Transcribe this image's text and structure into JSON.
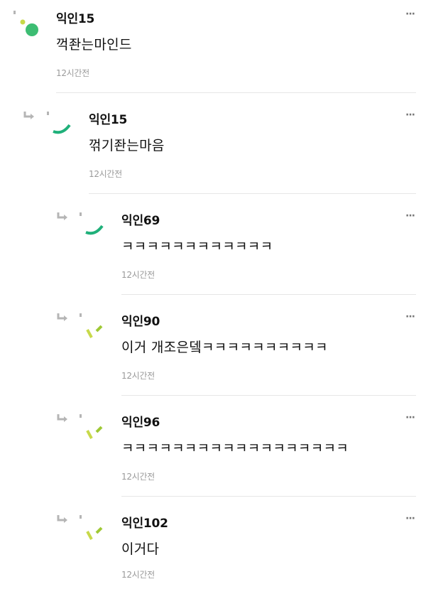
{
  "comments": [
    {
      "author": "익인15",
      "text": "꺽좐는마인드",
      "time": "12시간전"
    },
    {
      "author": "익인15",
      "text": "꺾기좐는마음",
      "time": "12시간전"
    },
    {
      "author": "익인69",
      "text": "ㅋㅋㅋㅋㅋㅋㅋㅋㅋㅋㅋㅋ",
      "time": "12시간전"
    },
    {
      "author": "익인90",
      "text": "이거 개조은뎈ㅋㅋㅋㅋㅋㅋㅋㅋㅋㅋ",
      "time": "12시간전"
    },
    {
      "author": "익인96",
      "text": "ㅋㅋㅋㅋㅋㅋㅋㅋㅋㅋㅋㅋㅋㅋㅋㅋㅋㅋ",
      "time": "12시간전"
    },
    {
      "author": "익인102",
      "text": "이거다",
      "time": "12시간전"
    }
  ],
  "more_label": "···",
  "colors": {
    "green_dot": "#3dbd73",
    "teal_arc": "#1fb07a",
    "lime": "#c8d94a",
    "lime_dark": "#9fc935",
    "gray_icon": "#b5b5b5"
  }
}
